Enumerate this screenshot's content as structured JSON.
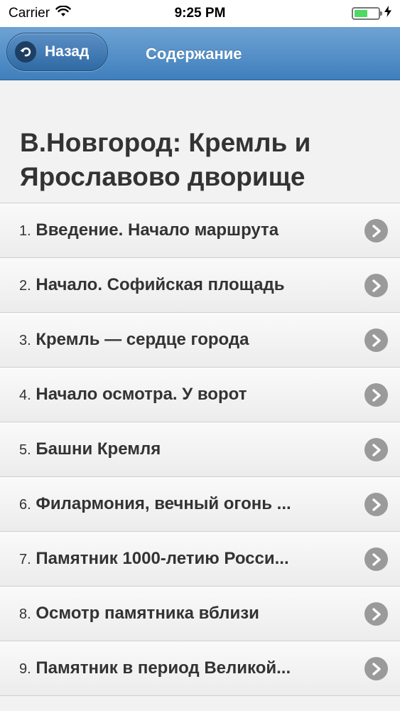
{
  "status_bar": {
    "carrier": "Carrier",
    "time": "9:25 PM",
    "battery_level": 0.55,
    "battery_color": "#4cd964"
  },
  "navbar": {
    "back_label": "Назад",
    "title": "Содержание",
    "gradient_top": "#6ea3d4",
    "gradient_bottom": "#3f7fbd"
  },
  "content": {
    "heading": "В.Новгород: Кремль и Ярославово дворище",
    "items": [
      {
        "number": "1.",
        "title": "Введение. Начало маршрута"
      },
      {
        "number": "2.",
        "title": "Начало. Софийская площадь"
      },
      {
        "number": "3.",
        "title": "Кремль — сердце города"
      },
      {
        "number": "4.",
        "title": "Начало осмотра. У ворот"
      },
      {
        "number": "5.",
        "title": "Башни Кремля"
      },
      {
        "number": "6.",
        "title": "Филармония, вечный огонь ..."
      },
      {
        "number": "7.",
        "title": "Памятник 1000-летию Росси..."
      },
      {
        "number": "8.",
        "title": "Осмотр памятника вблизи"
      },
      {
        "number": "9.",
        "title": "Памятник в период Великой..."
      }
    ],
    "row_icon": "chevron-right-circle-icon"
  }
}
